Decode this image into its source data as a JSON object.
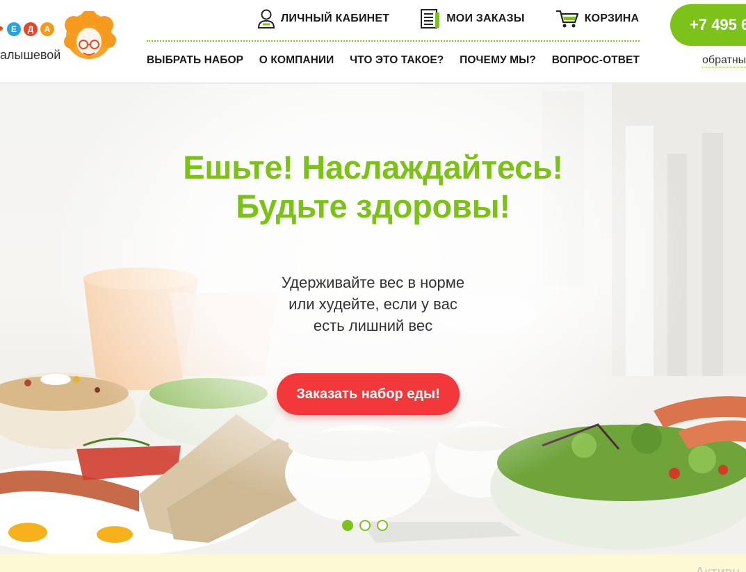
{
  "logo": {
    "badges": [
      {
        "letter": "Е",
        "color": "#29a3e0"
      },
      {
        "letter": "Д",
        "color": "#e4472a"
      },
      {
        "letter": "А",
        "color": "#f39a1a"
      }
    ],
    "text": "алышевой"
  },
  "topnav": [
    {
      "label": "ЛИЧНЫЙ КАБИНЕТ",
      "icon": "user-icon"
    },
    {
      "label": "МОИ ЗАКАЗЫ",
      "icon": "orders-list-icon"
    },
    {
      "label": "КОРЗИНА",
      "icon": "cart-icon"
    }
  ],
  "mainnav": [
    {
      "label": "ВЫБРАТЬ НАБОР"
    },
    {
      "label": "О КОМПАНИИ"
    },
    {
      "label": "ЧТО ЭТО ТАКОЕ?"
    },
    {
      "label": "ПОЧЕМУ МЫ?"
    },
    {
      "label": "ВОПРОС-ОТВЕТ"
    }
  ],
  "contact": {
    "phone": "+7 495 6",
    "callback": "обратны"
  },
  "hero": {
    "title_line1": "Ешьте! Наслаждайтесь!",
    "title_line2": "Будьте здоровы!",
    "sub_line1": "Удерживайте вес в норме",
    "sub_line2": "или худейте, если у вас",
    "sub_line3": "есть лишний вес",
    "cta": "Заказать набор еды!",
    "slides_total": 3,
    "slide_active": 1
  },
  "strip": {
    "text": "Активн"
  },
  "colors": {
    "green": "#7dc11b",
    "red": "#f2383a",
    "strip": "#fdf9d5"
  }
}
